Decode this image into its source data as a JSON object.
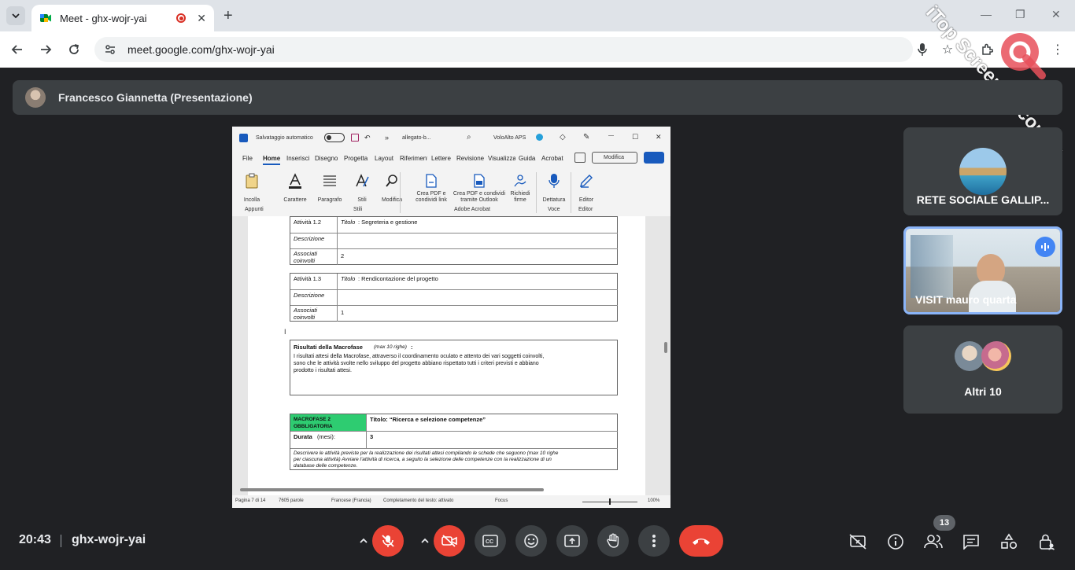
{
  "browser": {
    "tab_title": "Meet - ghx-wojr-yai",
    "url": "meet.google.com/ghx-wojr-yai"
  },
  "presenter": {
    "name": "Francesco Giannetta (Presentazione)"
  },
  "word": {
    "autosave_label": "Salvataggio automatico",
    "file_name": "allegato-b...",
    "account": "VoloAlto APS",
    "menu": [
      "File",
      "Home",
      "Inserisci",
      "Disegno",
      "Progetta",
      "Layout",
      "Riferimenti",
      "Lettere",
      "Revisione",
      "Visualizza",
      "Guida",
      "Acrobat"
    ],
    "edit_mode": "Modifica",
    "ribbon": {
      "paste": "Incolla",
      "clipboard_group": "Appunti",
      "font": "Carattere",
      "paragraph": "Paragrafo",
      "styles": "Stili",
      "styles_group": "Stili",
      "editing": "Modifica",
      "pdf_share": "Crea PDF e condividi link",
      "pdf_outlook": "Crea PDF e condividi tramite Outlook",
      "signatures": "Richiedi firme",
      "acrobat_group": "Adobe Acrobat",
      "dictate": "Dettatura",
      "voice_group": "Voce",
      "editor": "Editor",
      "editor_group": "Editor"
    },
    "doc": {
      "act12_label": "Attività 1.2",
      "act12_title_key": "Titolo",
      "act12_title": ": Segreteria e gestione",
      "desc_label": "Descrizione",
      "assoc_label_1": "Associati",
      "assoc_label_2": "coinvolti",
      "act12_assoc": "2",
      "act13_label": "Attività 1.3",
      "act13_title": ": Rendicontazione del progetto",
      "act13_assoc": "1",
      "results_heading": "Risultati della Macrofase",
      "results_note": "(max 10 righe)",
      "results_colon": ":",
      "results_text_1": "I risultati attesi della Macrofase, attraverso il coordinamento oculato e attento dei vari soggetti coinvolti,",
      "results_text_2": "sono che le attività svolte nello sviluppo del progetto abbiano rispettato tutti i criteri previsti e abbiano",
      "results_text_3": "prodotto i risultati attesi.",
      "macro_label_1": "MACROFASE 2",
      "macro_label_2": "OBBLIGATORIA",
      "macro_title": "Titolo: “Ricerca e selezione competenze”",
      "duration_label": "Durata",
      "duration_unit": "(mesi):",
      "duration_value": "3",
      "instructions_1": "Descrivere le attività previste per la realizzazione dei risultati attesi compilando le schede che seguono (max 10 righe",
      "instructions_2": "per ciascuna attività) Avviare l'attività di ricerca, a seguito la selezione delle competenze con la realizzazione di un",
      "instructions_3": "database delle competenze."
    },
    "status": {
      "page": "Pagina 7 di 14",
      "words": "7605 parole",
      "language": "Francese (Francia)",
      "predictions": "Completamento del testo: attivato",
      "focus": "Focus",
      "zoom": "100%"
    }
  },
  "tiles": {
    "t1_label": "RETE SOCIALE GALLIP...",
    "t2_label": "VISIT mauro quarta",
    "t3_label": "Altri 10"
  },
  "watermark": "iTop Screen Recorder",
  "bottom": {
    "time": "20:43",
    "meeting_code": "ghx-wojr-yai",
    "participants_badge": "13"
  },
  "colors": {
    "meet_bg": "#202124",
    "tile_bg": "#3c4043",
    "end_call": "#ea4335",
    "active_speaker": "#8ab4f8",
    "macro_green": "#2ecc71"
  }
}
